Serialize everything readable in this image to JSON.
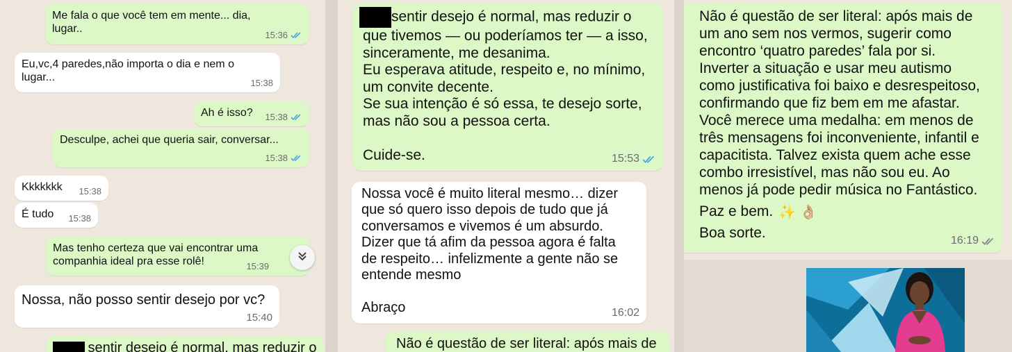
{
  "panel1": {
    "m1": {
      "text": "Me fala o que você tem em mente... dia,\nlugar..",
      "time": "15:36"
    },
    "m2": {
      "text": "Eu,vc,4 paredes,não importa o dia e nem o\nlugar...",
      "time": "15:38"
    },
    "m3": {
      "text": "Ah é isso?",
      "time": "15:38"
    },
    "m4": {
      "text": "Desculpe, achei que queria sair, conversar...",
      "time": "15:38"
    },
    "m5": {
      "text": "Kkkkkkk",
      "time": "15:38"
    },
    "m6": {
      "text": "É tudo",
      "time": "15:38"
    },
    "m7": {
      "text": "Mas tenho certeza que vai encontrar uma\ncompanhia ideal pra esse rolê!",
      "time": "15:39"
    },
    "m8": {
      "text": "Nossa, não posso sentir desejo por vc?",
      "time": "15:40"
    },
    "m9": {
      "text": "sentir desejo é normal, mas reduzir o"
    }
  },
  "panel2": {
    "m1": {
      "first_line": "sentir desejo é normal, mas reduzir o",
      "text": "que tivemos — ou poderíamos ter — a isso,\nsinceramente, me desanima.\nEu esperava atitude, respeito e, no mínimo,\num convite decente.\nSe sua intenção é só essa, te desejo sorte,\nmas não sou a pessoa certa.\n\nCuide-se.",
      "time": "15:53"
    },
    "m2": {
      "text": "Nossa você é muito literal mesmo… dizer\nque só quero isso depois de tudo que já\nconversamos e vivemos é um absurdo.\nDizer que tá afim da pessoa agora é falta\nde respeito… infelizmente a gente não se\nentende mesmo\n\nAbraço",
      "time": "16:02"
    },
    "m3": {
      "text": "Não é questão de ser literal: após mais de"
    }
  },
  "panel3": {
    "m1": {
      "text": "Não é questão de ser literal: após mais de\num ano sem nos vermos, sugerir como\nencontro ‘quatro paredes’ fala por si.\nInverter a situação e usar meu autismo\ncomo justificativa foi baixo e desrespeitoso,\nconfirmando que fiz bem em me afastar.\nVocê merece uma medalha: em menos de\ntrês mensagens foi inconveniente, infantil e\ncapacitista. Talvez exista quem ache esse\ncombo irresistível, mas não sou eu. Ao\nmenos já pode pedir música no Fantástico.",
      "sign": "Paz e bem.",
      "emojis": "✨ 👌🏼",
      "bye": "Boa sorte.",
      "time": "16:19"
    }
  },
  "icons": {
    "read": "double-check-icon",
    "scroll": "chevron-double-down-icon"
  },
  "colors": {
    "outgoing": "#dcf8c6",
    "incoming": "#ffffff",
    "read_tick": "#4fa3e0",
    "sent_tick": "#8a8a8a",
    "wallpaper": "#efe7dd"
  }
}
